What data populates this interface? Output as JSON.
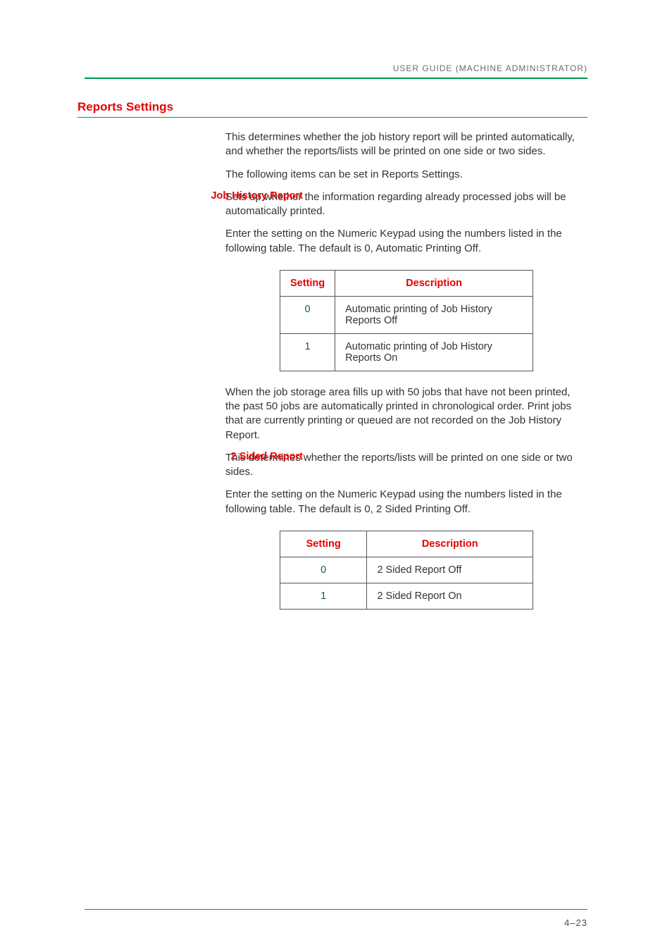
{
  "running_head": "USER GUIDE (MACHINE ADMINISTRATOR)",
  "section_title": "Reports Settings",
  "intro_p1": "This determines whether the job history report will be printed automatically, and whether the reports/lists will be printed on one side or two sides.",
  "intro_p2": "The following items can be set in Reports Settings.",
  "job_history": {
    "label": "Job History Report",
    "p1": "Sets up whether the information regarding already processed jobs will be automatically printed.",
    "p2": "Enter the setting on the Numeric Keypad using the numbers listed in the following table. The default is 0, Automatic Printing Off.",
    "table_headers": {
      "setting": "Setting",
      "description": "Description"
    },
    "rows": [
      {
        "setting": "0",
        "description": "Automatic printing of Job History Reports Off"
      },
      {
        "setting": "1",
        "description": "Automatic printing of Job History Reports On"
      }
    ],
    "p3": "When the job storage area fills up with 50 jobs that have not been printed, the past 50 jobs are automatically printed in chronological order.  Print jobs that are currently printing or queued are not recorded on the Job History Report."
  },
  "two_sided": {
    "label": "2 Sided Report",
    "p1": "This determines whether the reports/lists will be printed on one side or two sides.",
    "p2": "Enter the setting on the Numeric Keypad using the numbers listed in the following table. The default is 0, 2 Sided Printing Off.",
    "table_headers": {
      "setting": "Setting",
      "description": "Description"
    },
    "rows": [
      {
        "setting": "0",
        "description": "2 Sided Report Off"
      },
      {
        "setting": "1",
        "description": "2 Sided Report On"
      }
    ]
  },
  "page_number": "4–23"
}
